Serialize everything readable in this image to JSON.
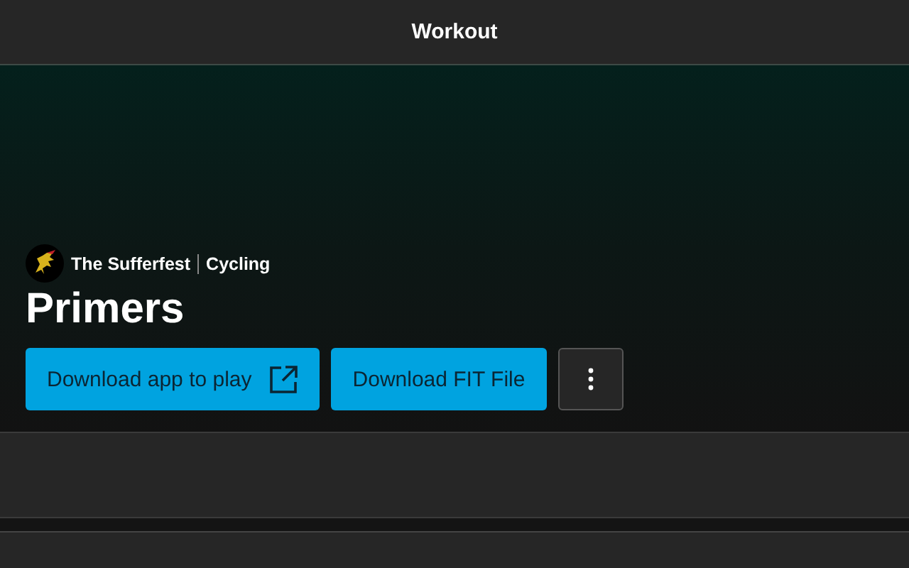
{
  "header": {
    "title": "Workout"
  },
  "brand": {
    "name": "The Sufferfest",
    "category": "Cycling"
  },
  "title": "Primers",
  "buttons": [
    {
      "label": "Download app to play",
      "external": true
    },
    {
      "label": "Download FIT File",
      "external": false
    }
  ]
}
